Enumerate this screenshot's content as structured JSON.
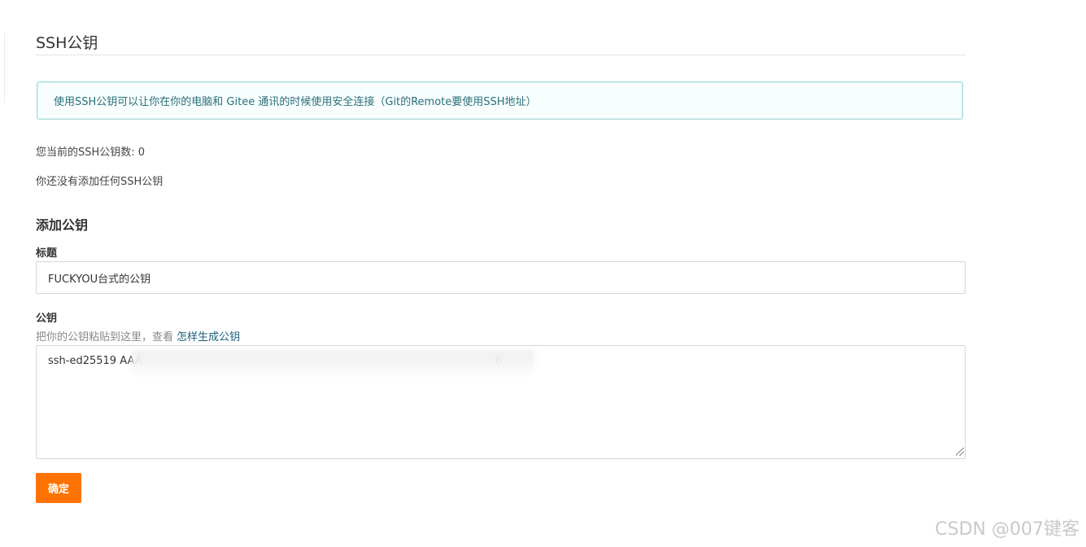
{
  "page": {
    "title": "SSH公钥"
  },
  "info": {
    "message": "使用SSH公钥可以让你在你的电脑和 Gitee 通讯的时候使用安全连接（Git的Remote要使用SSH地址）"
  },
  "status": {
    "count_text": "您当前的SSH公钥数: 0",
    "empty_text": "你还没有添加任何SSH公钥"
  },
  "form": {
    "section_title": "添加公钥",
    "title_label": "标题",
    "title_value": "FUCKYOU台式的公钥",
    "key_label": "公钥",
    "key_hint": "把你的公钥粘贴到这里，查看 ",
    "key_hint_link": "怎样生成公钥",
    "key_value": "ssh-ed25519 AAA                                                                                                         b",
    "submit_label": "确定"
  },
  "watermark": {
    "text": "CSDN @007键客"
  },
  "colors": {
    "accent": "#fe7300",
    "info_border": "#a6dcdc",
    "info_text": "#2a6f7a",
    "link": "#1a5f7a"
  }
}
